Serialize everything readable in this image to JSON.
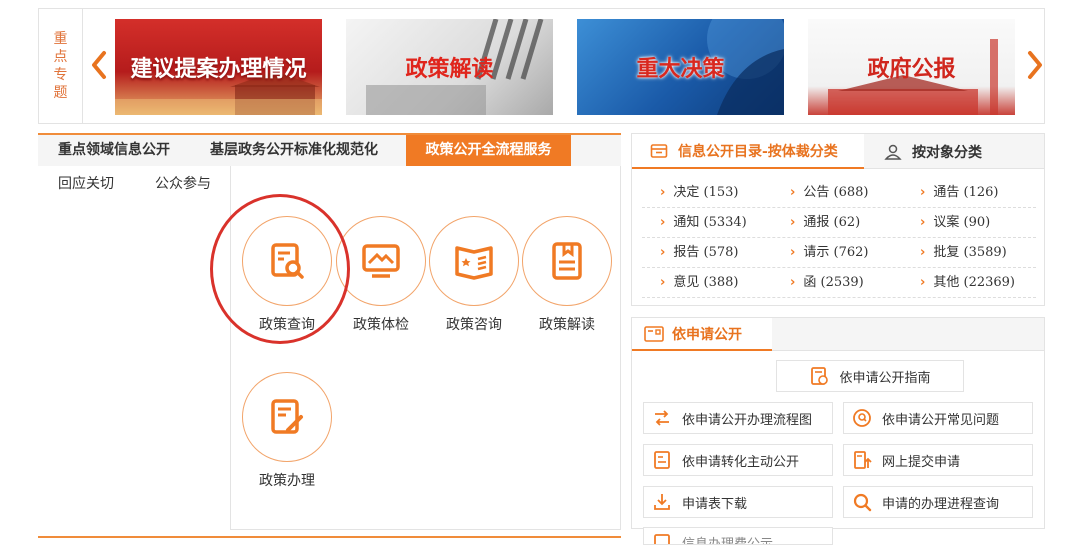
{
  "banner": {
    "tag": [
      "重",
      "点",
      "专",
      "题"
    ],
    "slides": [
      "建议提案办理情况",
      "政策解读",
      "重大决策",
      "政府公报"
    ]
  },
  "left_tabs": [
    "重点领域信息公开",
    "基层政务公开标准化规范化",
    "政策公开全流程服务"
  ],
  "sub_nav": [
    "回应关切",
    "公众参与"
  ],
  "services": [
    "政策查询",
    "政策体检",
    "政策咨询",
    "政策解读",
    "政策办理"
  ],
  "catalog": {
    "tab_active": "信息公开目录-按体裁分类",
    "tab_other": "按对象分类",
    "items": [
      [
        "决定 (153)",
        "公告 (688)",
        "通告 (126)"
      ],
      [
        "通知 (5334)",
        "通报 (62)",
        "议案 (90)"
      ],
      [
        "报告 (578)",
        "请示 (762)",
        "批复 (3589)"
      ],
      [
        "意见 (388)",
        "函 (2539)",
        "其他 (22369)"
      ]
    ]
  },
  "apply": {
    "title": "依申请公开",
    "guide": "依申请公开指南",
    "buttons": [
      "依申请公开办理流程图",
      "依申请公开常见问题",
      "依申请转化主动公开",
      "网上提交申请",
      "申请表下载",
      "申请的办理进程查询",
      "信息办理费公示"
    ]
  },
  "colors": {
    "accent": "#f07a24",
    "highlight_ring": "#d9322b"
  }
}
